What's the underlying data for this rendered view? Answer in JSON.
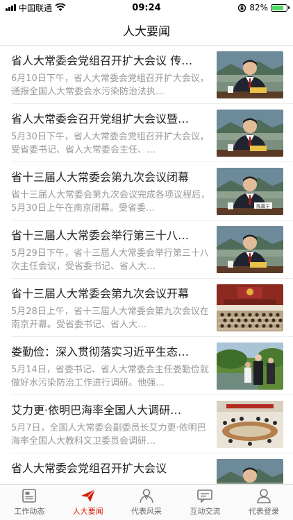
{
  "status": {
    "carrier": "中国联通",
    "time": "09:24",
    "battery_text": "82%",
    "battery_level": 0.82
  },
  "header": {
    "title": "人大要闻"
  },
  "news": [
    {
      "title": "省人大常委会党组召开扩大会议 传…",
      "summary": "6月10日下午，省人大常委会党组召开扩大会议，通报全国人大常委会水污染防治法执…",
      "thumb": "official-speaking"
    },
    {
      "title": "省人大常委会召开党组扩大会议暨…",
      "summary": "5月30日下午，省人大常委会党组召开扩大会议，受省委书记、省人大常委会主任、…",
      "thumb": "official-speaking"
    },
    {
      "title": "省十三届人大常委会第九次会议闭幕",
      "summary": "省十三届人大常委会第九次会议完成各项议程后，5月30日上午在南京闭幕。受省委…",
      "thumb": "official-nameplate",
      "nameplate": "陈震宁"
    },
    {
      "title": "省十三届人大常委会举行第三十八…",
      "summary": "5月29日下午，省十三届人大常委会举行第三十八次主任会议，受省委书记、省人大…",
      "thumb": "official-speaking"
    },
    {
      "title": "省十三届人大常委会第九次会议开幕",
      "summary": "5月28日上午，省十三届人大常委会第九次会议在南京开幕。受省委书记、省人大…",
      "thumb": "meeting-hall"
    },
    {
      "title": "娄勤俭：深入贯彻落实习近平生态…",
      "summary": "5月14日，省委书记、省人大常委会主任娄勤俭就做好水污染防治工作进行调研。他强…",
      "thumb": "outdoor-inspection"
    },
    {
      "title": "艾力更·依明巴海率全国人大调研…",
      "summary": "5月7日，全国人大常委会副委员长艾力更·依明巴海率全国人大教科文卫委员会调研…",
      "thumb": "conference-table"
    },
    {
      "title": "省人大常委会党组召开扩大会议",
      "summary": "",
      "thumb": "official-speaking"
    }
  ],
  "tabs": [
    {
      "label": "工作动态",
      "icon": "newspaper-icon",
      "active": false
    },
    {
      "label": "人大要闻",
      "icon": "paper-plane-icon",
      "active": true
    },
    {
      "label": "代表风采",
      "icon": "person-icon",
      "active": false
    },
    {
      "label": "互动交流",
      "icon": "chat-icon",
      "active": false
    },
    {
      "label": "代表登录",
      "icon": "user-login-icon",
      "active": false
    }
  ],
  "colors": {
    "accent": "#d81e06",
    "tab_inactive": "#666666",
    "summary_gray": "#999999"
  }
}
